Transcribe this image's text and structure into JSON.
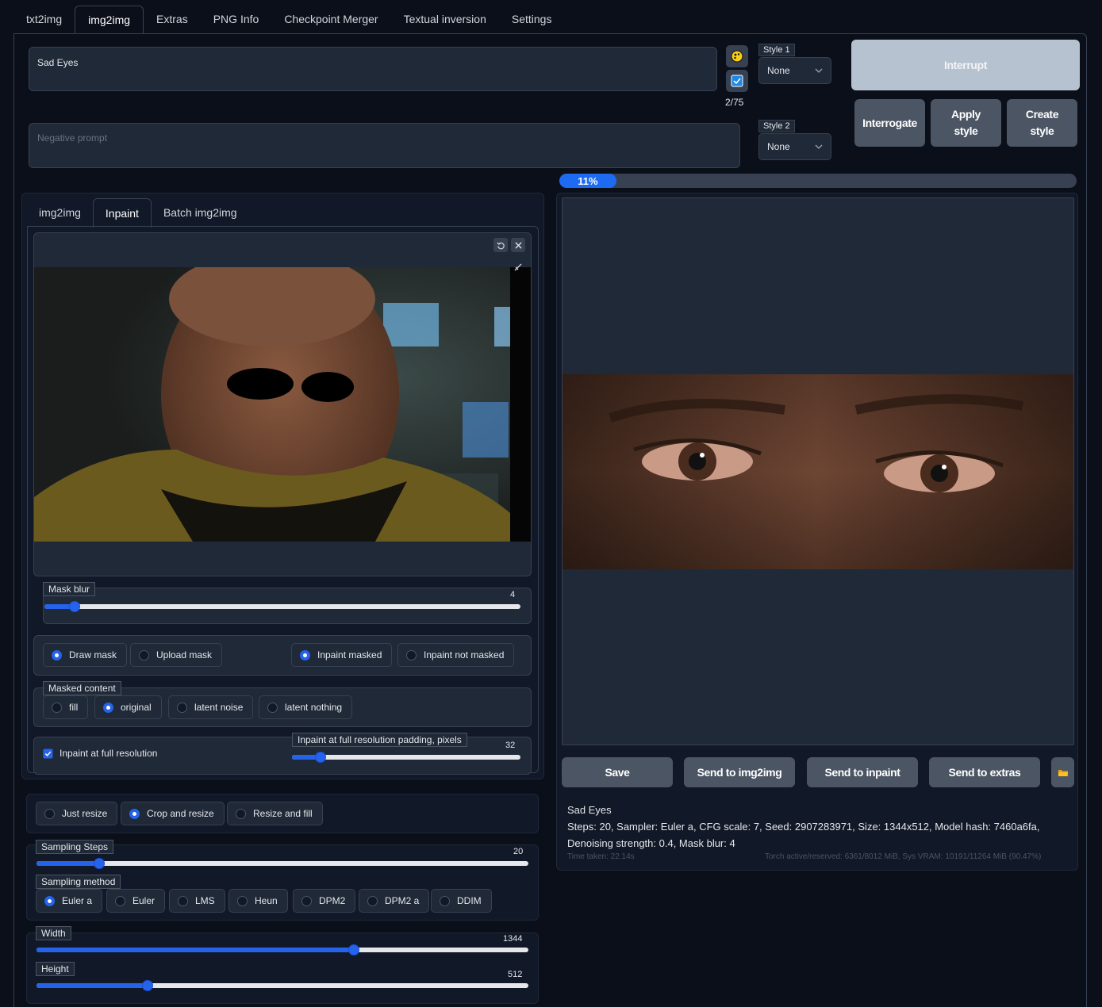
{
  "top_tabs": [
    "txt2img",
    "img2img",
    "Extras",
    "PNG Info",
    "Checkpoint Merger",
    "Textual inversion",
    "Settings"
  ],
  "prompt": {
    "value": "Sad Eyes",
    "token_count": "2/75"
  },
  "negative_prompt": {
    "placeholder": "Negative prompt"
  },
  "styles": {
    "style1_label": "Style 1",
    "style1_value": "None",
    "style2_label": "Style 2",
    "style2_value": "None"
  },
  "buttons": {
    "interrupt": "Interrupt",
    "interrogate": "Interrogate",
    "apply_style": "Apply style",
    "create_style": "Create style"
  },
  "progress": {
    "text": "11%",
    "fraction": 0.11
  },
  "mode_tabs": [
    "img2img",
    "Inpaint",
    "Batch img2img"
  ],
  "mask_blur": {
    "label": "Mask blur",
    "value": "4",
    "min": 0,
    "max": 64
  },
  "mask_mode": {
    "options": [
      "Draw mask",
      "Upload mask"
    ],
    "selected": "Draw mask"
  },
  "inpaint_mode": {
    "options": [
      "Inpaint masked",
      "Inpaint not masked"
    ],
    "selected": "Inpaint masked"
  },
  "masked_content": {
    "label": "Masked content",
    "options": [
      "fill",
      "original",
      "latent noise",
      "latent nothing"
    ],
    "selected": "original"
  },
  "full_res": {
    "label": "Inpaint at full resolution",
    "checked": true,
    "padding_label": "Inpaint at full resolution padding, pixels",
    "padding_value": "32",
    "padding_min": 0,
    "padding_max": 256
  },
  "resize_mode": {
    "options": [
      "Just resize",
      "Crop and resize",
      "Resize and fill"
    ],
    "selected": "Crop and resize"
  },
  "sampling_steps": {
    "label": "Sampling Steps",
    "value": "20",
    "min": 1,
    "max": 150
  },
  "sampling_method": {
    "label": "Sampling method",
    "options": [
      "Euler a",
      "Euler",
      "LMS",
      "Heun",
      "DPM2",
      "DPM2 a",
      "DDIM"
    ],
    "selected": "Euler a"
  },
  "width": {
    "label": "Width",
    "value": "1344",
    "min": 64,
    "max": 2048
  },
  "height": {
    "label": "Height",
    "value": "512",
    "min": 64,
    "max": 2048
  },
  "output_buttons": [
    "Save",
    "Send to img2img",
    "Send to inpaint",
    "Send to extras"
  ],
  "info": {
    "prompt": "Sad Eyes",
    "params_line1": "Steps: 20, Sampler: Euler a, CFG scale: 7, Seed: 2907283971, Size: 1344x512, Model hash: 7460a6fa,",
    "params_line2": "Denoising strength: 0.4, Mask blur: 4",
    "time": "Time taken: 22.14s",
    "vram": "Torch active/reserved: 6361/8012 MiB, Sys VRAM: 10191/11264 MiB (90.47%)"
  },
  "colors": {
    "accent": "#2563eb",
    "bg": "#0b0f19",
    "panel": "#1f2937"
  }
}
